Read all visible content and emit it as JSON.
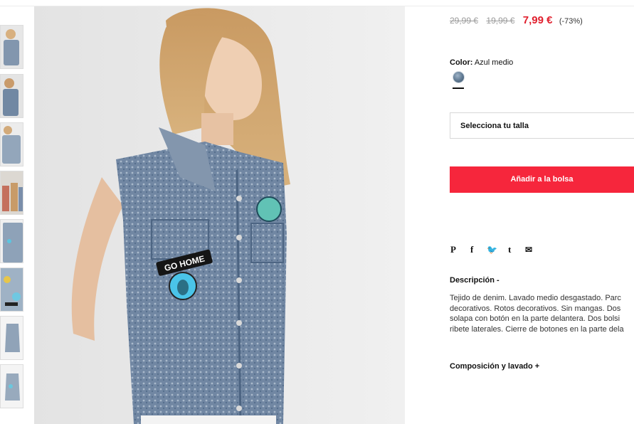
{
  "prices": {
    "original": "29,99 €",
    "previous": "19,99 €",
    "current": "7,99 €",
    "discount": "(-73%)"
  },
  "color": {
    "label": "Color:",
    "value": "Azul medio",
    "swatch_name": "denim-swatch"
  },
  "size_select": {
    "placeholder": "Selecciona tu talla"
  },
  "add_to_bag": {
    "label": "Añadir a la bolsa"
  },
  "share": {
    "icons": [
      "pinterest-icon",
      "facebook-icon",
      "twitter-icon",
      "tumblr-icon",
      "email-icon"
    ],
    "pinterest": "P",
    "facebook": "f",
    "twitter": "🐦",
    "tumblr": "t",
    "email": "✉"
  },
  "description": {
    "title": "Descripción -",
    "lines": [
      "Tejido de denim. Lavado medio desgastado. Parc",
      "decorativos. Rotos decorativos. Sin mangas. Dos",
      "solapa con botón en la parte delantera. Dos bolsi",
      "ribete laterales. Cierre de botones en la parte dela"
    ]
  },
  "composition": {
    "title": "Composición y lavado +"
  },
  "image": {
    "patch_text": "GO HOME"
  },
  "colors": {
    "accent": "#f6263c",
    "sale": "#e01f2d",
    "denim": "#6f86a3"
  }
}
